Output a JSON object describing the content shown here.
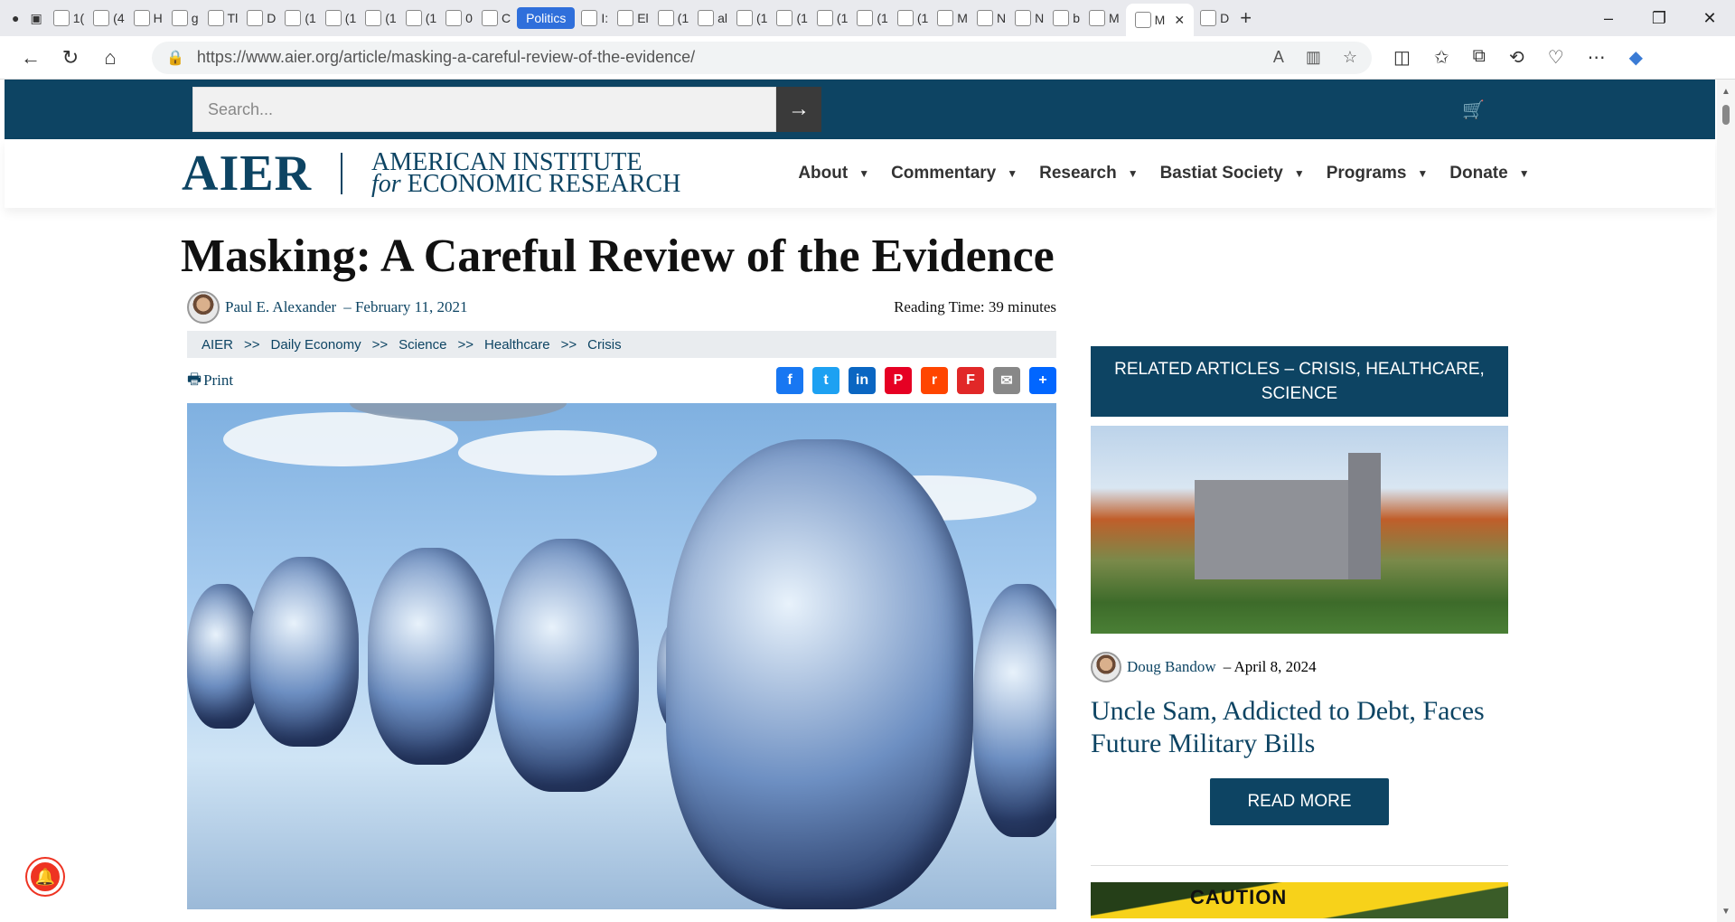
{
  "browser": {
    "tabs": [
      {
        "label": "1(",
        "icon": "doc-icon"
      },
      {
        "label": "(4",
        "icon": "grammarly-icon"
      },
      {
        "label": "H",
        "icon": "avatar-icon"
      },
      {
        "label": "g",
        "icon": "search-icon"
      },
      {
        "label": "Tl",
        "icon": "doc-icon"
      },
      {
        "label": "D",
        "icon": "doc-icon"
      },
      {
        "label": "(1",
        "icon": "doc-icon"
      },
      {
        "label": "(1",
        "icon": "bookmark-icon"
      },
      {
        "label": "(1",
        "icon": "bookmark-icon"
      },
      {
        "label": "(1",
        "icon": "bookmark-icon"
      },
      {
        "label": "0",
        "icon": "doc-icon"
      },
      {
        "label": "C",
        "icon": "doc-icon"
      }
    ],
    "pill_tab": "Politics",
    "tabs2": [
      {
        "label": "I:",
        "icon": "doc-icon"
      },
      {
        "label": "El",
        "icon": "doc-icon"
      },
      {
        "label": "(1",
        "icon": "doc-icon"
      },
      {
        "label": "al",
        "icon": "yahoo-icon"
      },
      {
        "label": "(1",
        "icon": "bookmark-icon"
      },
      {
        "label": "(1",
        "icon": "bookmark-icon"
      },
      {
        "label": "(1",
        "icon": "bookmark-icon"
      },
      {
        "label": "(1",
        "icon": "bookmark-icon"
      },
      {
        "label": "(1",
        "icon": "bookmark-icon"
      },
      {
        "label": "M",
        "icon": "youtube-icon"
      },
      {
        "label": "N",
        "icon": "r-icon"
      },
      {
        "label": "N",
        "icon": "doc-icon"
      },
      {
        "label": "b",
        "icon": "yahoo-icon"
      },
      {
        "label": "M",
        "icon": "bi-icon"
      }
    ],
    "active_tab": "M",
    "last_tab": "D",
    "url": "https://www.aier.org/article/masking-a-careful-review-of-the-evidence/"
  },
  "site": {
    "search_placeholder": "Search...",
    "logo_main": "AIER",
    "logo_line1": "AMERICAN INSTITUTE",
    "logo_for": "for",
    "logo_line2": "ECONOMIC RESEARCH",
    "menu": [
      "About",
      "Commentary",
      "Research",
      "Bastiat Society",
      "Programs",
      "Donate"
    ]
  },
  "article": {
    "title": "Masking: A Careful Review of the Evidence",
    "author": "Paul E. Alexander",
    "date": "February 11, 2021",
    "reading_time": "Reading Time: 39 minutes",
    "breadcrumbs": [
      "AIER",
      "Daily Economy",
      "Science",
      "Healthcare",
      "Crisis"
    ],
    "crumb_sep": ">>",
    "print_label": "Print"
  },
  "share": [
    {
      "name": "facebook-icon",
      "glyph": "f",
      "color": "#1877f2"
    },
    {
      "name": "twitter-icon",
      "glyph": "t",
      "color": "#1da1f2"
    },
    {
      "name": "linkedin-icon",
      "glyph": "in",
      "color": "#0a66c2"
    },
    {
      "name": "pinterest-icon",
      "glyph": "P",
      "color": "#e60023"
    },
    {
      "name": "reddit-icon",
      "glyph": "r",
      "color": "#ff4500"
    },
    {
      "name": "flipboard-icon",
      "glyph": "F",
      "color": "#e12828"
    },
    {
      "name": "email-icon",
      "glyph": "✉",
      "color": "#888888"
    },
    {
      "name": "share-icon",
      "glyph": "+",
      "color": "#0166ff"
    }
  ],
  "sidebar": {
    "heading": "RELATED ARTICLES – CRISIS, HEALTHCARE, SCIENCE",
    "author": "Doug Bandow",
    "date": "April 8, 2024",
    "title": "Uncle Sam, Addicted to Debt, Faces Future Military Bills",
    "read_more": "READ MORE",
    "next_image_text": "CAUTION"
  },
  "colors": {
    "brand": "#0d4463"
  }
}
